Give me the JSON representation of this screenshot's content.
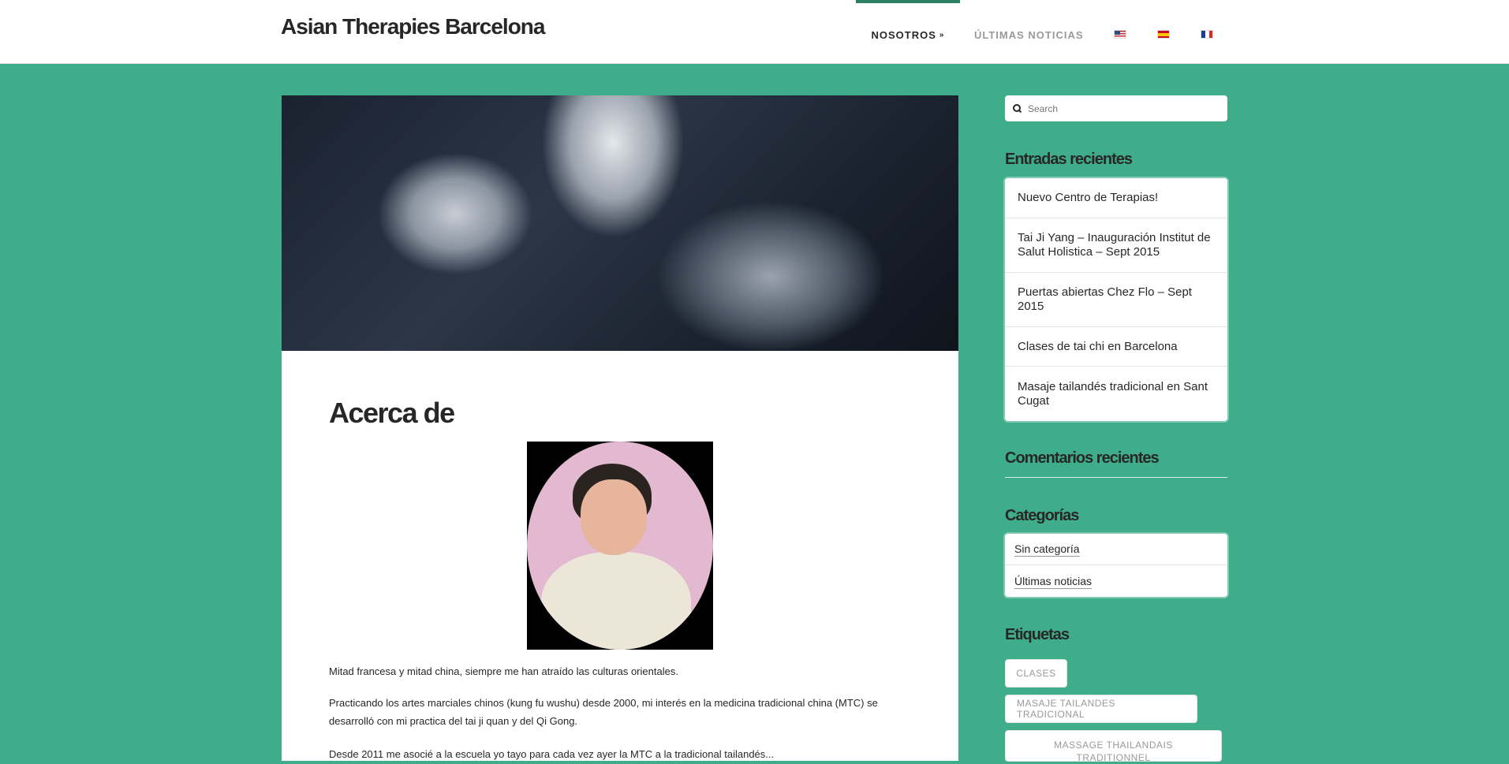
{
  "header": {
    "site_title": "Asian Therapies Barcelona",
    "nav": {
      "about": "NOSOTROS",
      "news": "ÚLTIMAS NOTICIAS"
    },
    "accent_color": "#2a7f65"
  },
  "colors": {
    "background": "#3fac8a",
    "card": "#ffffff",
    "text": "#272727"
  },
  "main": {
    "title": "Acerca de",
    "paragraphs": [
      "Mitad francesa y mitad china, siempre me han atraído las culturas orientales.",
      "Practicando los artes marciales chinos (kung fu wushu) desde 2000, mi interés en la medicina tradicional china (MTC) se desarrolló con mi practica del tai ji quan y del Qi Gong.",
      "Desde 2011 me asocié a la escuela yo tayo para cada vez ayer la MTC a la tradicional tailandés..."
    ]
  },
  "sidebar": {
    "search_placeholder": "Search",
    "recent_posts_title": "Entradas recientes",
    "recent_posts": [
      "Nuevo Centro de Terapias!",
      "Tai Ji Yang – Inauguración Institut de Salut Holistica – Sept 2015",
      "Puertas abiertas Chez Flo – Sept 2015",
      "Clases de tai chi en Barcelona",
      "Masaje tailandés tradicional en Sant Cugat"
    ],
    "recent_comments_title": "Comentarios recientes",
    "categories_title": "Categorías",
    "categories": [
      "Sin categoría",
      "Últimas noticias"
    ],
    "tags_title": "Etiquetas",
    "tags": [
      "CLASES",
      "MASAJE TAILANDES TRADICIONAL",
      "MASSAGE THAILANDAIS TRADITIONNEL"
    ]
  }
}
